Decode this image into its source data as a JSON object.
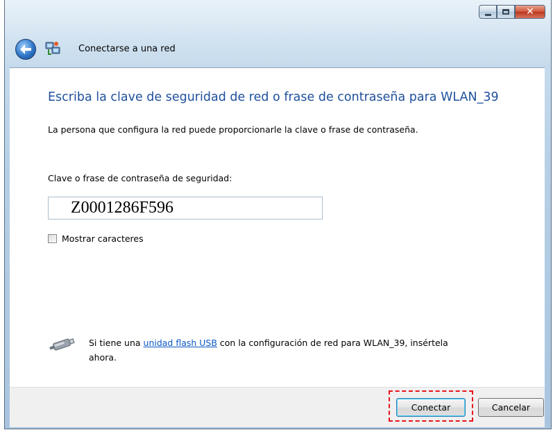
{
  "window": {
    "title": "Conectarse a una red",
    "caption_buttons": [
      "minimize",
      "maximize",
      "close"
    ]
  },
  "icons": {
    "back": "back-arrow-icon",
    "network": "network-connection-icon",
    "usb": "usb-flash-drive-icon"
  },
  "main": {
    "heading": "Escriba la clave de seguridad de red o frase de contraseña para WLAN_39",
    "description": "La persona que configura la red puede proporcionarle la clave o frase de contraseña.",
    "field_label": "Clave o frase de contraseña de seguridad:",
    "field_value": "Z0001286F596",
    "show_chars_label": "Mostrar caracteres",
    "show_chars_checked": false,
    "usb_prefix": "Si tiene una ",
    "usb_link": "unidad flash USB",
    "usb_suffix": " con la configuración de red para WLAN_39, insértela ahora."
  },
  "footer": {
    "connect_label": "Conectar",
    "cancel_label": "Cancelar"
  },
  "colors": {
    "heading": "#1e4f9c",
    "link": "#0b57c5",
    "highlight": "#e8121a"
  }
}
